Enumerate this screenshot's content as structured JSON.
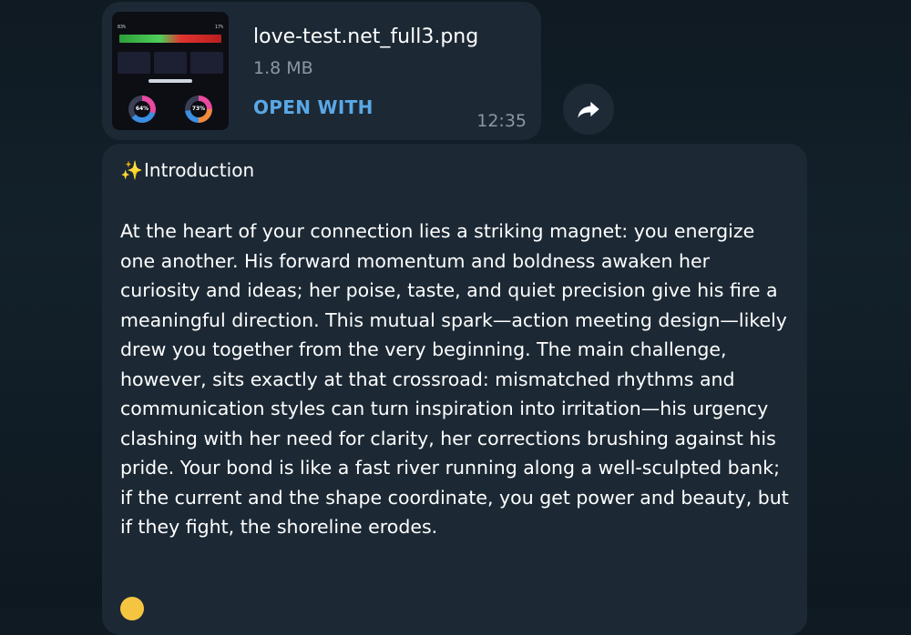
{
  "file_message": {
    "file_name": "love-test.net_full3.png",
    "file_size": "1.8 MB",
    "open_with_label": "OPEN WITH",
    "time": "12:35",
    "thumbnail": {
      "left_pct": "83%",
      "right_pct": "17%",
      "ring_left_value": "64%",
      "ring_right_value": "73%"
    }
  },
  "text_message": {
    "heading_emoji": "✨",
    "heading": "Introduction",
    "body": "At the heart of your connection lies a striking magnet: you energize one another. His forward momentum and boldness awaken her curiosity and ideas; her poise, taste, and quiet precision give his fire a meaningful direction. This mutual spark—action meeting design—likely drew you together from the very beginning. The main challenge, however, sits exactly at that crossroad: mismatched rhythms and communication styles can turn inspiration into irritation—his urgency clashing with her need for clarity, her corrections brushing against his pride. Your bond is like a fast river running along a well-sculpted bank; if the current and the shape coordinate, you get power and beauty, but if they fight, the shoreline erodes."
  },
  "colors": {
    "bubble": "#1c2935",
    "accent": "#5aa8e6",
    "muted": "#8b97a3"
  },
  "icons": {
    "forward": "forward-arrow-icon",
    "sparkles": "sparkles-icon"
  }
}
